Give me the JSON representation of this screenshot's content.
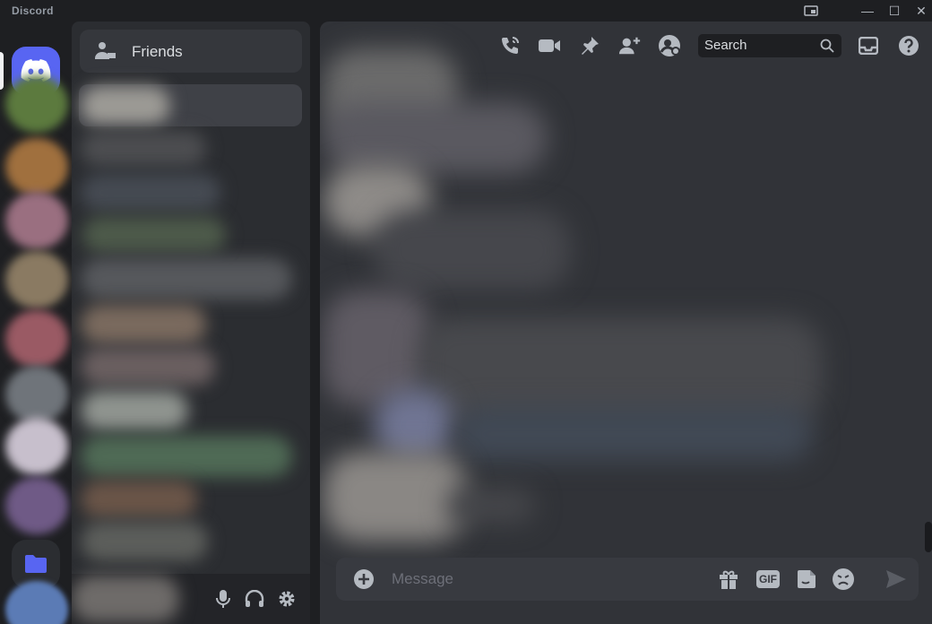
{
  "app": {
    "title": "Discord"
  },
  "window_controls": {
    "minimize": "—",
    "maximize": "☐",
    "close": "✕"
  },
  "dm_panel": {
    "friends_label": "Friends"
  },
  "chat": {
    "search_placeholder": "Search",
    "message_placeholder": "Message"
  },
  "composer": {
    "gif_label": "GIF"
  },
  "colors": {
    "accent": "#5865f2",
    "background": "#313338",
    "sidebar": "#2b2d31",
    "rail": "#1e1f22"
  },
  "icons": [
    "discord-logo-icon",
    "folder-icon",
    "friends-icon",
    "microphone-icon",
    "headphones-icon",
    "settings-icon",
    "voice-call-icon",
    "video-call-icon",
    "pin-icon",
    "add-member-icon",
    "user-profile-icon",
    "search-icon",
    "inbox-icon",
    "help-icon",
    "add-attachment-icon",
    "gift-icon",
    "gif-icon",
    "sticker-icon",
    "emoji-icon",
    "send-icon"
  ]
}
